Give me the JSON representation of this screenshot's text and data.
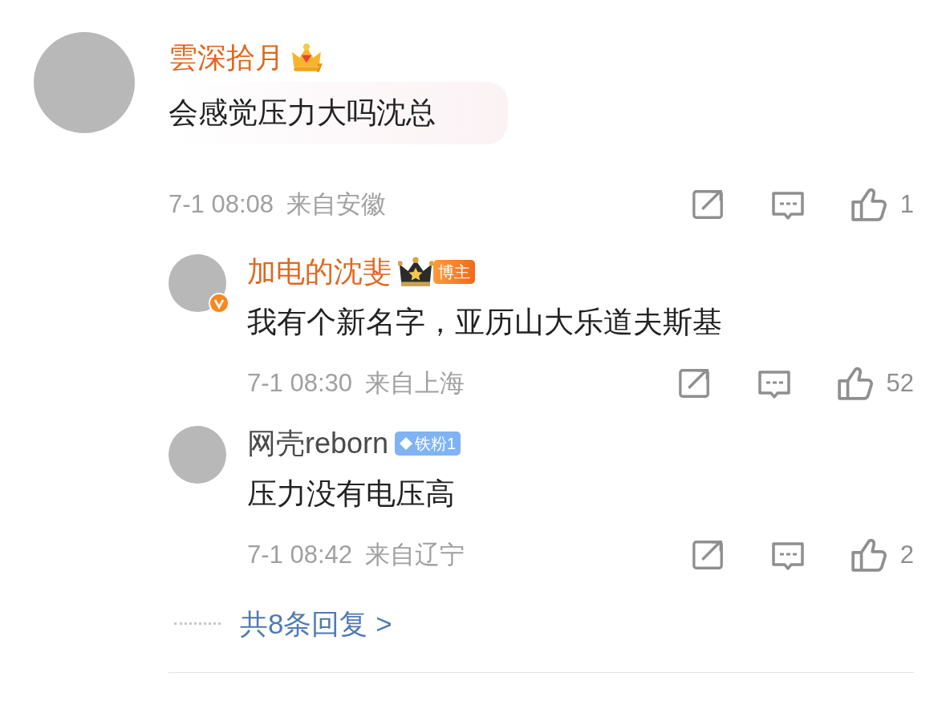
{
  "comment": {
    "name": "雲深拾月",
    "color": "#e0661f",
    "badge": {
      "kind": "crown"
    },
    "verified": false,
    "text": "会感觉压力大吗沈总",
    "bubble": true,
    "time": "7-1 08:08",
    "location": "来自安徽",
    "likes": "1"
  },
  "replies": [
    {
      "name": "加电的沈斐",
      "color": "#e0661f",
      "badge": {
        "kind": "blogger",
        "label": "博主"
      },
      "verified": true,
      "text": "我有个新名字，亚历山大乐道夫斯基",
      "time": "7-1 08:30",
      "location": "来自上海",
      "likes": "52"
    },
    {
      "name": "网壳reborn",
      "color": "#4a4a4a",
      "badge": {
        "kind": "fan",
        "label": "铁粉1"
      },
      "verified": false,
      "text": "压力没有电压高",
      "time": "7-1 08:42",
      "location": "来自辽宁",
      "likes": "2"
    }
  ],
  "more_replies": "共8条回复 >"
}
